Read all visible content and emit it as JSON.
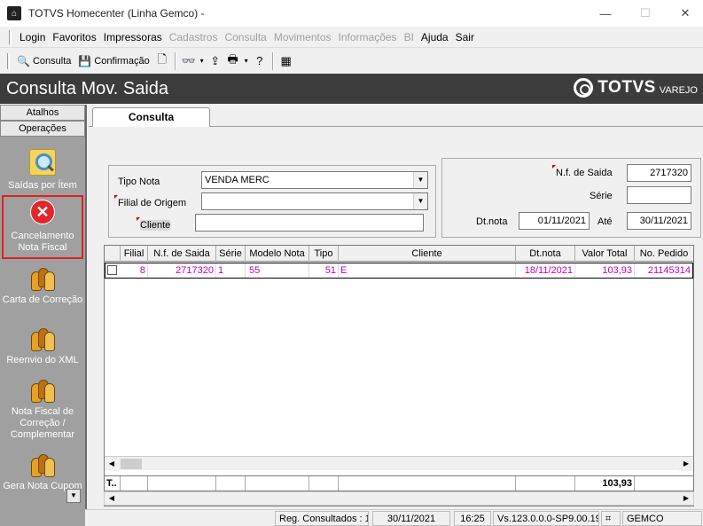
{
  "window": {
    "title": "TOTVS Homecenter (Linha Gemco) -",
    "min_glyph": "—",
    "max_glyph": "☐",
    "close_glyph": "✕"
  },
  "menu": [
    {
      "label": "Login",
      "enabled": true
    },
    {
      "label": "Favoritos",
      "enabled": true
    },
    {
      "label": "Impressoras",
      "enabled": true
    },
    {
      "label": "Cadastros",
      "enabled": false
    },
    {
      "label": "Consulta",
      "enabled": false
    },
    {
      "label": "Movimentos",
      "enabled": false
    },
    {
      "label": "Informações",
      "enabled": false
    },
    {
      "label": "BI",
      "enabled": false
    },
    {
      "label": "Ajuda",
      "enabled": true
    },
    {
      "label": "Sair",
      "enabled": true
    }
  ],
  "toolbar": {
    "consulta_label": "Consulta",
    "confirmacao_label": "Confirmação"
  },
  "header": {
    "page_title": "Consulta Mov. Saida",
    "brand": "TOTVS",
    "brand_sub": "VAREJO"
  },
  "sidebar": {
    "tab_atalhos": "Atalhos",
    "tab_operacoes": "Operações",
    "items": [
      {
        "label": "Saídas por Ítem"
      },
      {
        "label": "Cancelamento Nota Fiscal"
      },
      {
        "label": "Carta de Correção"
      },
      {
        "label": "Reenvio do XML"
      },
      {
        "label": "Nota Fiscal de Correção / Complementar"
      },
      {
        "label": "Gera Nota Cupom"
      }
    ]
  },
  "tabs": {
    "consulta": "Consulta"
  },
  "filters": {
    "tipo_nota_label": "Tipo Nota",
    "tipo_nota_value": "VENDA MERC",
    "filial_origem_label": "Filial de Origem",
    "filial_origem_value": "",
    "cliente_label": "Cliente",
    "cliente_value": "",
    "nf_saida_label": "N.f. de Saida",
    "nf_saida_value": "2717320",
    "serie_label": "Série",
    "serie_value": "",
    "dt_nota_label": "Dt.nota",
    "dt_nota_from": "01/11/2021",
    "ate_label": "Até",
    "dt_nota_to": "30/11/2021"
  },
  "grid": {
    "columns": [
      "Filial",
      "N.f. de Saida",
      "Série",
      "Modelo Nota",
      "Tipo",
      "Cliente",
      "Dt.nota",
      "Valor Total",
      "No. Pedido"
    ],
    "rows": [
      {
        "filial": "8",
        "nf": "2717320",
        "serie": "1",
        "modelo": "55",
        "tipo": "51",
        "cliente": "E",
        "dt_nota": "18/11/2021",
        "valor": "103,93",
        "pedido": "21145314"
      }
    ],
    "total_label": "T..",
    "total_value": "103,93"
  },
  "status": {
    "reg_consultados": "Reg. Consultados : 1",
    "date": "30/11/2021",
    "time": "16:25",
    "version": "Vs.123.0.0.0-SP9.00.19",
    "company": "GEMCO"
  }
}
